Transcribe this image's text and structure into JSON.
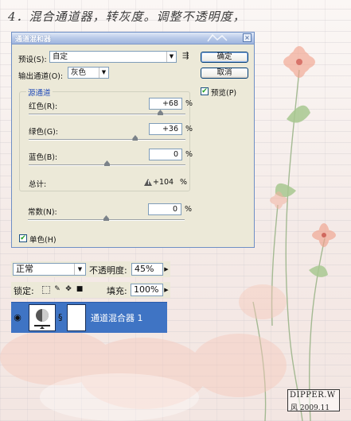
{
  "page": {
    "heading": "4．混合通道器，转灰度。调整不透明度，",
    "stamp_line1": "DIPPER.W",
    "stamp_line2": "风 2009.11"
  },
  "dialog": {
    "title": "通道混和器",
    "close_glyph": "×",
    "preset_label": "预设(S):",
    "preset_value": "自定",
    "output_label": "输出通道(O):",
    "output_value": "灰色",
    "group_label": "源通道",
    "channels": [
      {
        "label": "红色(R):",
        "value": "+68",
        "unit": "%",
        "level": 0.84
      },
      {
        "label": "绿色(G):",
        "value": "+36",
        "unit": "%",
        "level": 0.68
      },
      {
        "label": "蓝色(B):",
        "value": "0",
        "unit": "%",
        "level": 0.5
      }
    ],
    "total_label": "总计:",
    "total_value": "+104",
    "total_unit": "%",
    "constant_label": "常数(N):",
    "constant_value": "0",
    "constant_unit": "%",
    "constant_level": 0.5,
    "mono_label": "单色(H)",
    "mono_checked": true,
    "ok_label": "确定",
    "reset_label": "取消",
    "preview_label": "预览(P)",
    "preview_checked": true
  },
  "layers": {
    "blend_mode": "正常",
    "opacity_label": "不透明度:",
    "opacity_value": "45%",
    "lock_label": "锁定:",
    "fill_label": "填充:",
    "fill_value": "100%",
    "layer_name": "通道混合器 1"
  },
  "colors": {
    "dialog_bg": "#ece9d8",
    "titlebar": "#b8c9e8",
    "selected_layer": "#3f74c4",
    "group_label_blue": "#1f49b8"
  }
}
